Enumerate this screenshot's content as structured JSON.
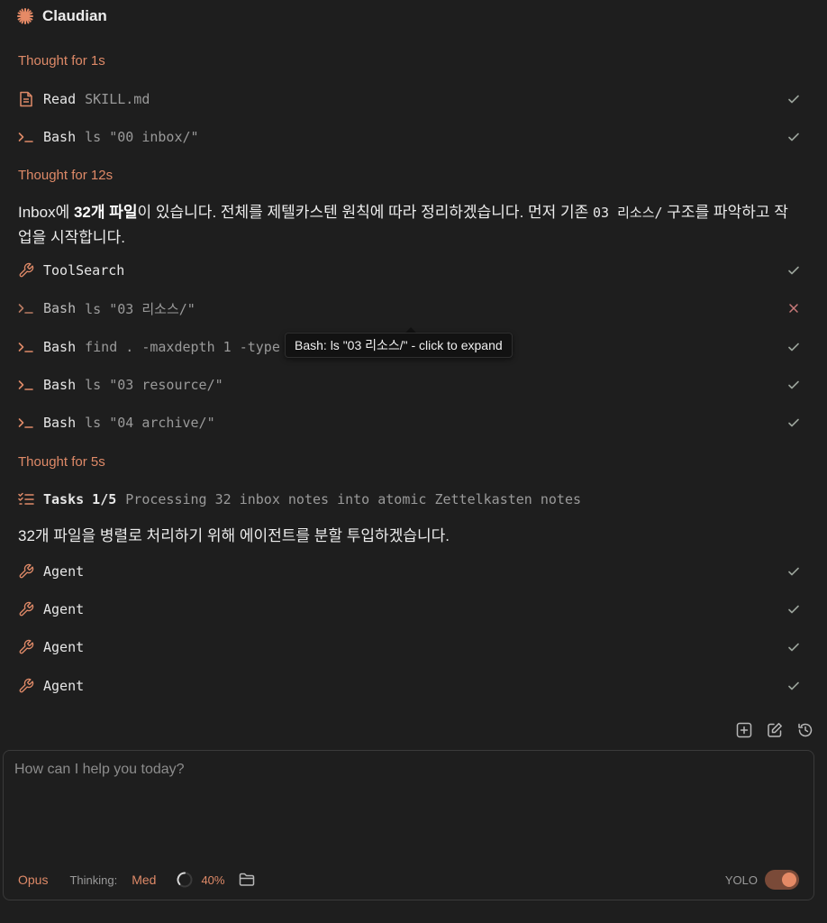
{
  "app": {
    "title": "Claudian"
  },
  "thoughts": [
    "Thought for 1s",
    "Thought for 12s",
    "Thought for 5s"
  ],
  "tools": [
    {
      "icon": "file-icon",
      "name": "Read",
      "args": "SKILL.md",
      "status": "success"
    },
    {
      "icon": "terminal-icon",
      "name": "Bash",
      "args": "ls \"00 inbox/\"",
      "status": "success"
    },
    {
      "icon": "wrench-icon",
      "name": "ToolSearch",
      "args": "",
      "status": "success"
    },
    {
      "icon": "terminal-icon",
      "name": "Bash",
      "args": "ls \"03 리소스/\"",
      "status": "error"
    },
    {
      "icon": "terminal-icon",
      "name": "Bash",
      "args": "find . -maxdepth 1 -type",
      "status": "success"
    },
    {
      "icon": "terminal-icon",
      "name": "Bash",
      "args": "ls \"03 resource/\"",
      "status": "success"
    },
    {
      "icon": "terminal-icon",
      "name": "Bash",
      "args": "ls \"04 archive/\"",
      "status": "success"
    },
    {
      "icon": "tasks-icon",
      "name": "Tasks 1/5",
      "args": "Processing 32 inbox notes into atomic Zettelkasten notes",
      "status": "none"
    },
    {
      "icon": "wrench-icon",
      "name": "Agent",
      "args": "",
      "status": "success"
    },
    {
      "icon": "wrench-icon",
      "name": "Agent",
      "args": "",
      "status": "success"
    },
    {
      "icon": "wrench-icon",
      "name": "Agent",
      "args": "",
      "status": "success"
    },
    {
      "icon": "wrench-icon",
      "name": "Agent",
      "args": "",
      "status": "success"
    }
  ],
  "message1": {
    "p1": "Inbox에 ",
    "bold": "32개 파일",
    "p2": "이 있습니다. 전체를 제텔카스텐 원칙에 따라 정리하겠습니다. 먼저 기존 ",
    "code": "03 리소스/",
    "p3": " 구조를 파악하고 작업을 시작합니다."
  },
  "message2": "32개 파일을 병렬로 처리하기 위해 에이전트를 분할 투입하겠습니다.",
  "tooltip": "Bash: ls \"03 리소스/\" - click to expand",
  "composer": {
    "placeholder": "How can I help you today?",
    "model": "Opus",
    "thinking_label": "Thinking:",
    "thinking_value": "Med",
    "context_percent": "40%",
    "yolo_label": "YOLO",
    "yolo_on": true
  },
  "colors": {
    "accent": "#df8a68",
    "success": "#9aa39a",
    "error": "#c97a7a"
  }
}
